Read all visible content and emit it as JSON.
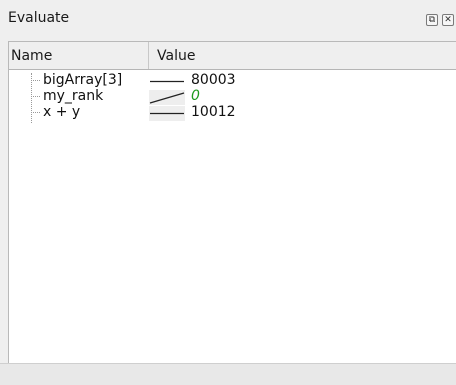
{
  "panel": {
    "title": "Evaluate",
    "float_icon_glyph": "⧉",
    "close_icon_glyph": "✕"
  },
  "columns": {
    "name": "Name",
    "value": "Value"
  },
  "rows": [
    {
      "name": "bigArray[3]",
      "value": "80003",
      "changed": false,
      "sparkline": "flat"
    },
    {
      "name": "my_rank",
      "value": "0",
      "changed": true,
      "sparkline": "rising"
    },
    {
      "name": "x + y",
      "value": "10012",
      "changed": false,
      "sparkline": "flat"
    }
  ],
  "colors": {
    "changed_value": "#1e9a1e"
  }
}
